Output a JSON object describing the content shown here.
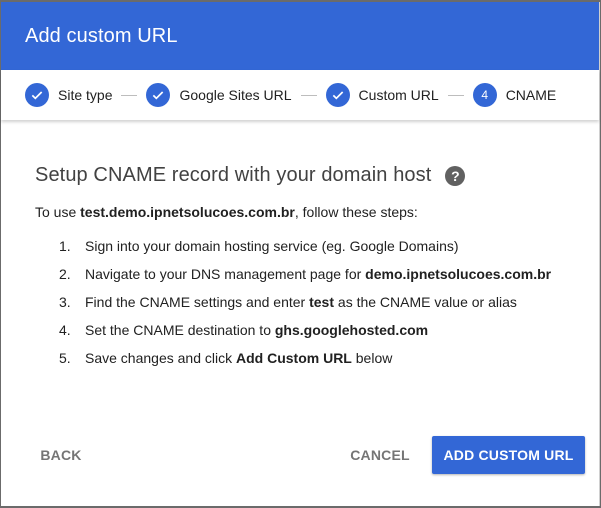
{
  "dialog": {
    "title": "Add custom URL"
  },
  "stepper": {
    "steps": [
      {
        "label": "Site type",
        "number": "1",
        "done": true
      },
      {
        "label": "Google Sites URL",
        "number": "2",
        "done": true
      },
      {
        "label": "Custom URL",
        "number": "3",
        "done": true
      },
      {
        "label": "CNAME",
        "number": "4",
        "done": false
      }
    ]
  },
  "content": {
    "heading": "Setup CNAME record with your domain host",
    "help_icon": "?",
    "intro": {
      "before": "To use ",
      "domain": "test.demo.ipnetsolucoes.com.br",
      "after": ", follow these steps:"
    },
    "steps": [
      {
        "number": "1.",
        "parts": [
          {
            "text": "Sign into your domain hosting service (eg. Google Domains)",
            "bold": false
          }
        ]
      },
      {
        "number": "2.",
        "parts": [
          {
            "text": "Navigate to your DNS management page for ",
            "bold": false
          },
          {
            "text": "demo.ipnetsolucoes.com.br",
            "bold": true
          }
        ]
      },
      {
        "number": "3.",
        "parts": [
          {
            "text": "Find the CNAME settings and enter ",
            "bold": false
          },
          {
            "text": "test",
            "bold": true
          },
          {
            "text": " as the CNAME value or alias",
            "bold": false
          }
        ]
      },
      {
        "number": "4.",
        "parts": [
          {
            "text": "Set the CNAME destination to ",
            "bold": false
          },
          {
            "text": "ghs.googlehosted.com",
            "bold": true
          }
        ]
      },
      {
        "number": "5.",
        "parts": [
          {
            "text": "Save changes and click ",
            "bold": false
          },
          {
            "text": "Add Custom URL",
            "bold": true
          },
          {
            "text": " below",
            "bold": false
          }
        ]
      }
    ]
  },
  "footer": {
    "back_label": "BACK",
    "cancel_label": "CANCEL",
    "add_label": "ADD CUSTOM URL"
  },
  "colors": {
    "accent": "#3367d6"
  }
}
